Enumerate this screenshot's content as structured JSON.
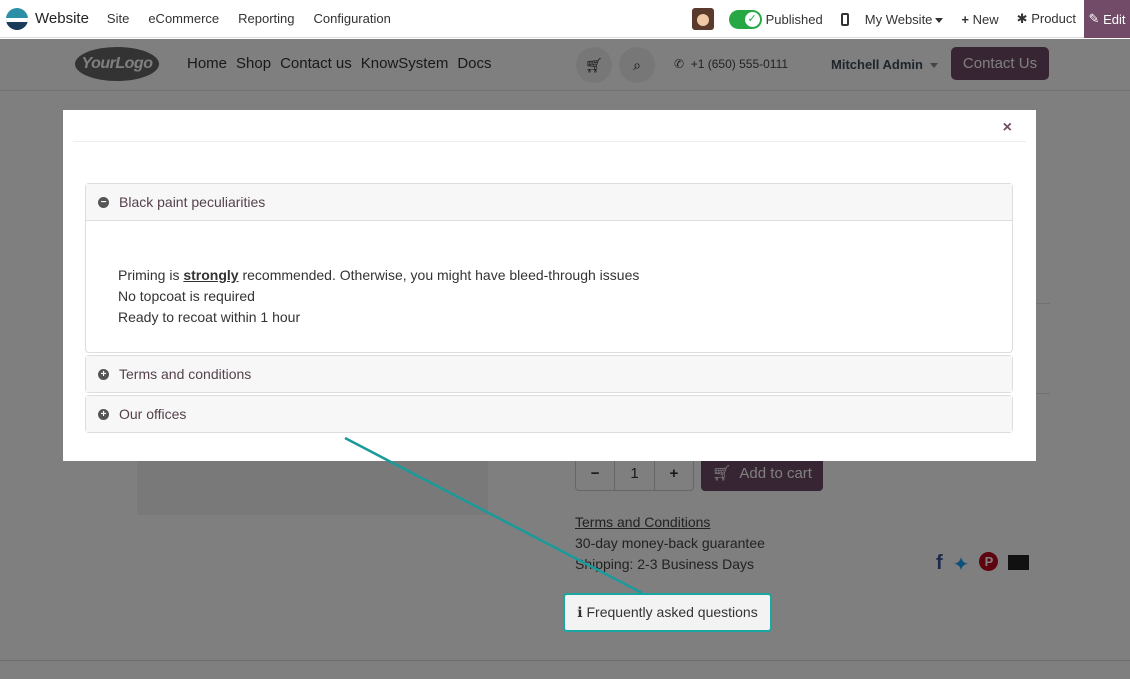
{
  "odoo_bar": {
    "app_name": "Website",
    "menus": [
      "Site",
      "eCommerce",
      "Reporting",
      "Configuration"
    ],
    "published_label": "Published",
    "my_website_label": "My Website",
    "new_label": "New",
    "product_label": "Product",
    "edit_label": "Edit"
  },
  "header": {
    "logo_text": "YourLogo",
    "nav": [
      "Home",
      "Shop",
      "Contact us",
      "KnowSystem",
      "Docs"
    ],
    "phone": "+1 (650) 555-0111",
    "user": "Mitchell Admin",
    "contact_button": "Contact Us"
  },
  "modal": {
    "close_symbol": "×",
    "accordion": [
      {
        "title": "Black paint peculiarities",
        "expanded": true,
        "body": {
          "line1_pre": "Priming is ",
          "line1_bold": "strongly",
          "line1_post": " recommended. Otherwise, you might have bleed-through issues",
          "line2": "No topcoat is required",
          "line3": "Ready to recoat within 1 hour"
        }
      },
      {
        "title": "Terms and conditions",
        "expanded": false
      },
      {
        "title": "Our offices",
        "expanded": false
      }
    ]
  },
  "product": {
    "quantity": "1",
    "add_to_cart": "Add to cart",
    "terms_link": "Terms and Conditions",
    "guarantee": "30-day money-back guarantee",
    "shipping": "Shipping: 2-3 Business Days",
    "faq_button": "Frequently asked questions"
  },
  "colors": {
    "brand": "#714b67",
    "accent": "#1aa7a1",
    "published_toggle": "#28a745"
  },
  "icons": {
    "cart": "cart-icon",
    "search": "search-icon",
    "phone": "phone-icon",
    "close": "close-icon",
    "collapse": "minus-circle-icon",
    "expand": "plus-circle-icon",
    "info": "info-icon"
  }
}
